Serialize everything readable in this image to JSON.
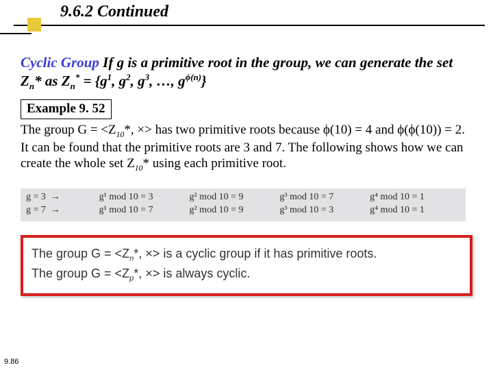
{
  "header": {
    "title": "9.6.2  Continued"
  },
  "cyclic": {
    "lead": "Cyclic Group",
    "body_html": " If g is a primitive root in the group, we can generate the set Z<sub>n</sub>* as  Z<sub>n</sub><sup>*</sup> = {g<sup>1</sup>, g<sup>2</sup>, g<sup>3</sup>, …, g<sup>ϕ(n)</sup>}"
  },
  "example": {
    "badge": "Example 9. 52",
    "text_html": "The group G = &lt;Z<sub>10</sub>*, ×&gt; has two primitive roots because ϕ(10) = 4 and ϕ(ϕ(10)) = 2. It can be found that the primitive roots are 3 and 7. The following shows how we can create the whole set Z<sub>10</sub>* using each primitive root."
  },
  "table": {
    "rows": [
      {
        "lead": "g = 3  →",
        "cells": [
          "g¹ mod 10 = 3",
          "g² mod 10 = 9",
          "g³ mod 10 = 7",
          "g⁴ mod 10 = 1"
        ]
      },
      {
        "lead": "g = 7  →",
        "cells": [
          "g¹ mod 10 = 7",
          "g² mod 10 = 9",
          "g³ mod 10 = 3",
          "g⁴ mod 10 = 1"
        ]
      }
    ]
  },
  "callout": {
    "line1_html": "The group G = &lt;Z<sub>n</sub>*, ×&gt; is a cyclic group if it has primitive roots.",
    "line2_html": "The group G = &lt;Z<sub>p</sub>*, ×&gt; is always cyclic."
  },
  "page_number": "9.86"
}
